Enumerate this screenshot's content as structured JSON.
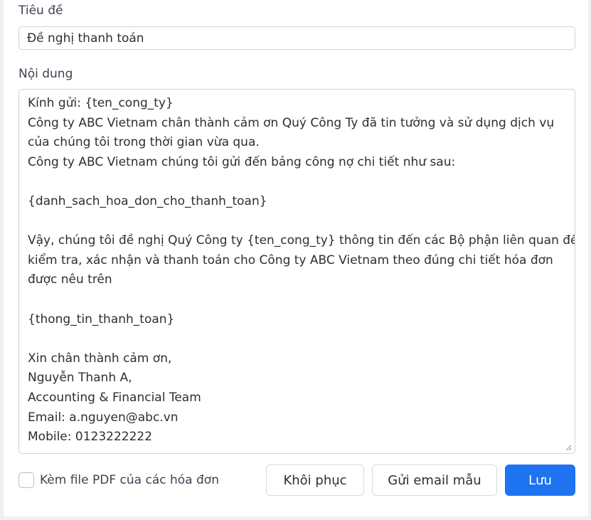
{
  "form": {
    "title_label": "Tiêu đề",
    "title_value": "Đề nghị thanh toán",
    "content_label": "Nội dung",
    "content_lines": [
      "Kính gửi: {ten_cong_ty}",
      "Công ty ABC Vietnam chân thành cảm ơn Quý Công Ty đã tin tưởng và sử dụng dịch vụ",
      "của chúng tôi trong thời gian vừa qua.",
      "Công ty ABC Vietnam chúng tôi gửi đến bảng công nợ chi tiết như sau:",
      "",
      "{danh_sach_hoa_don_cho_thanh_toan}",
      "",
      "Vậy, chúng tôi đề nghị Quý Công ty {ten_cong_ty} thông tin đến các Bộ phận liên quan để",
      "kiểm tra, xác nhận và thanh toán cho Công ty ABC Vietnam theo đúng chi tiết hóa đơn",
      "được nêu trên",
      "",
      "{thong_tin_thanh_toan}",
      "",
      "Xin chân thành cảm ơn,",
      "Nguyễn Thanh A,",
      "Accounting & Financial Team",
      "Email: a.nguyen@abc.vn",
      "Mobile: 0123222222"
    ],
    "attach_pdf_label": "Kèm file PDF của các hóa đơn",
    "attach_pdf_checked": false
  },
  "actions": {
    "restore_label": "Khôi phục",
    "send_sample_label": "Gửi email mẫu",
    "save_label": "Lưu"
  },
  "colors": {
    "primary": "#1e73f0",
    "spellcheck": "#d93025"
  }
}
